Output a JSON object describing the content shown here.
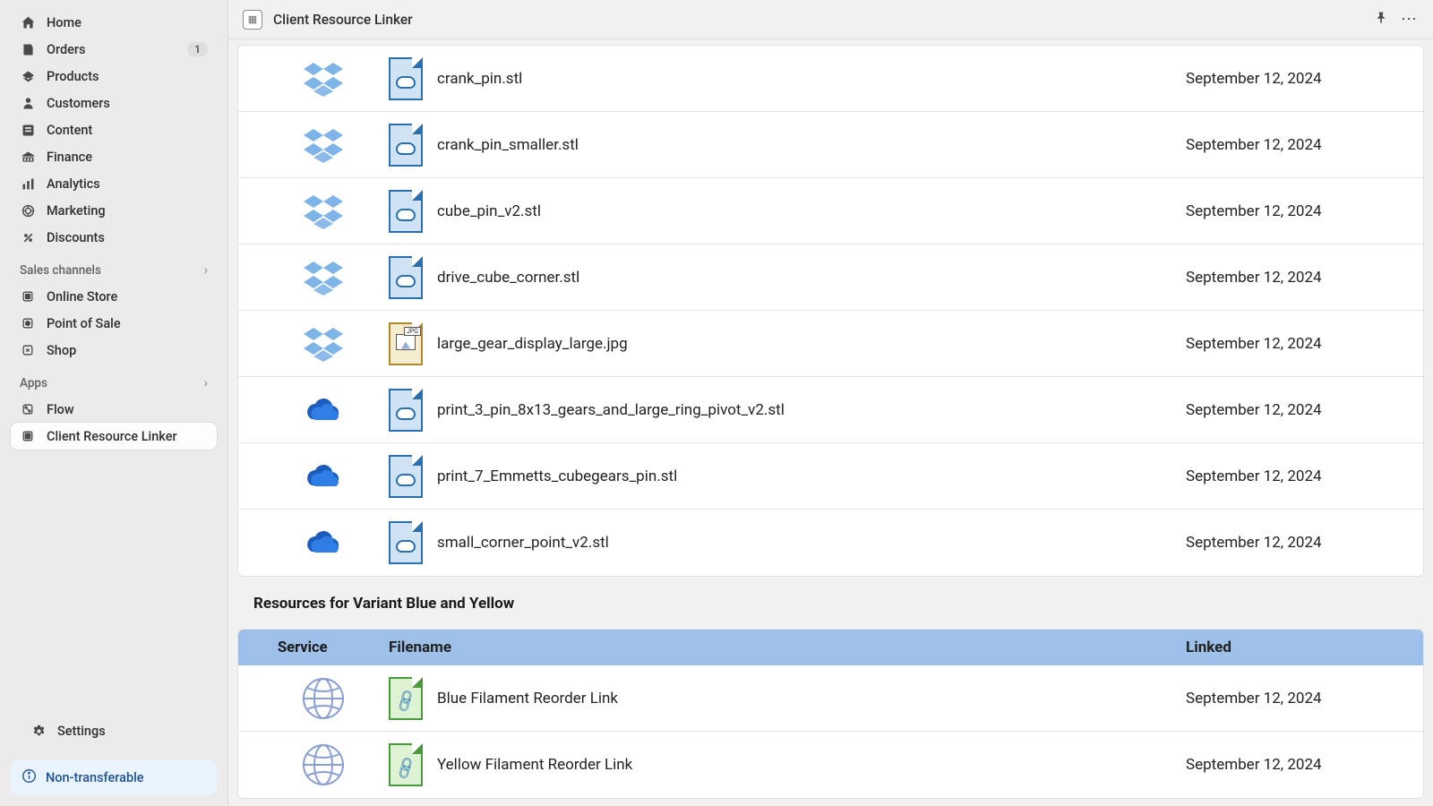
{
  "sidebar": {
    "nav": [
      {
        "icon": "home",
        "label": "Home"
      },
      {
        "icon": "orders",
        "label": "Orders",
        "badge": "1"
      },
      {
        "icon": "products",
        "label": "Products"
      },
      {
        "icon": "customers",
        "label": "Customers"
      },
      {
        "icon": "content",
        "label": "Content"
      },
      {
        "icon": "finance",
        "label": "Finance"
      },
      {
        "icon": "analytics",
        "label": "Analytics"
      },
      {
        "icon": "marketing",
        "label": "Marketing"
      },
      {
        "icon": "discounts",
        "label": "Discounts"
      }
    ],
    "sales_channels_label": "Sales channels",
    "channels": [
      {
        "icon": "store",
        "label": "Online Store"
      },
      {
        "icon": "pos",
        "label": "Point of Sale"
      },
      {
        "icon": "shop",
        "label": "Shop"
      }
    ],
    "apps_label": "Apps",
    "apps": [
      {
        "icon": "flow",
        "label": "Flow"
      },
      {
        "icon": "crl",
        "label": "Client Resource Linker",
        "active": true
      }
    ],
    "settings_label": "Settings",
    "non_transferable_label": "Non-transferable"
  },
  "topbar": {
    "title": "Client Resource Linker"
  },
  "resources": [
    {
      "service": "dropbox",
      "filetype": "cloud",
      "filename": "crank_pin.stl",
      "date": "September 12, 2024"
    },
    {
      "service": "dropbox",
      "filetype": "cloud",
      "filename": "crank_pin_smaller.stl",
      "date": "September 12, 2024"
    },
    {
      "service": "dropbox",
      "filetype": "cloud",
      "filename": "cube_pin_v2.stl",
      "date": "September 12, 2024"
    },
    {
      "service": "dropbox",
      "filetype": "cloud",
      "filename": "drive_cube_corner.stl",
      "date": "September 12, 2024"
    },
    {
      "service": "dropbox",
      "filetype": "jpg",
      "filename": "large_gear_display_large.jpg",
      "date": "September 12, 2024"
    },
    {
      "service": "onedrive",
      "filetype": "cloud",
      "filename": "print_3_pin_8x13_gears_and_large_ring_pivot_v2.stl",
      "date": "September 12, 2024"
    },
    {
      "service": "onedrive",
      "filetype": "cloud",
      "filename": "print_7_Emmetts_cubegears_pin.stl",
      "date": "September 12, 2024"
    },
    {
      "service": "onedrive",
      "filetype": "cloud",
      "filename": "small_corner_point_v2.stl",
      "date": "September 12, 2024"
    }
  ],
  "variant_heading": "Resources for Variant Blue and Yellow",
  "variant_table": {
    "headers": {
      "service": "Service",
      "filename": "Filename",
      "linked": "Linked"
    },
    "rows": [
      {
        "service": "web",
        "filetype": "link",
        "filename": "Blue Filament Reorder Link",
        "date": "September 12, 2024"
      },
      {
        "service": "web",
        "filetype": "link",
        "filename": "Yellow Filament Reorder Link",
        "date": "September 12, 2024"
      }
    ]
  }
}
